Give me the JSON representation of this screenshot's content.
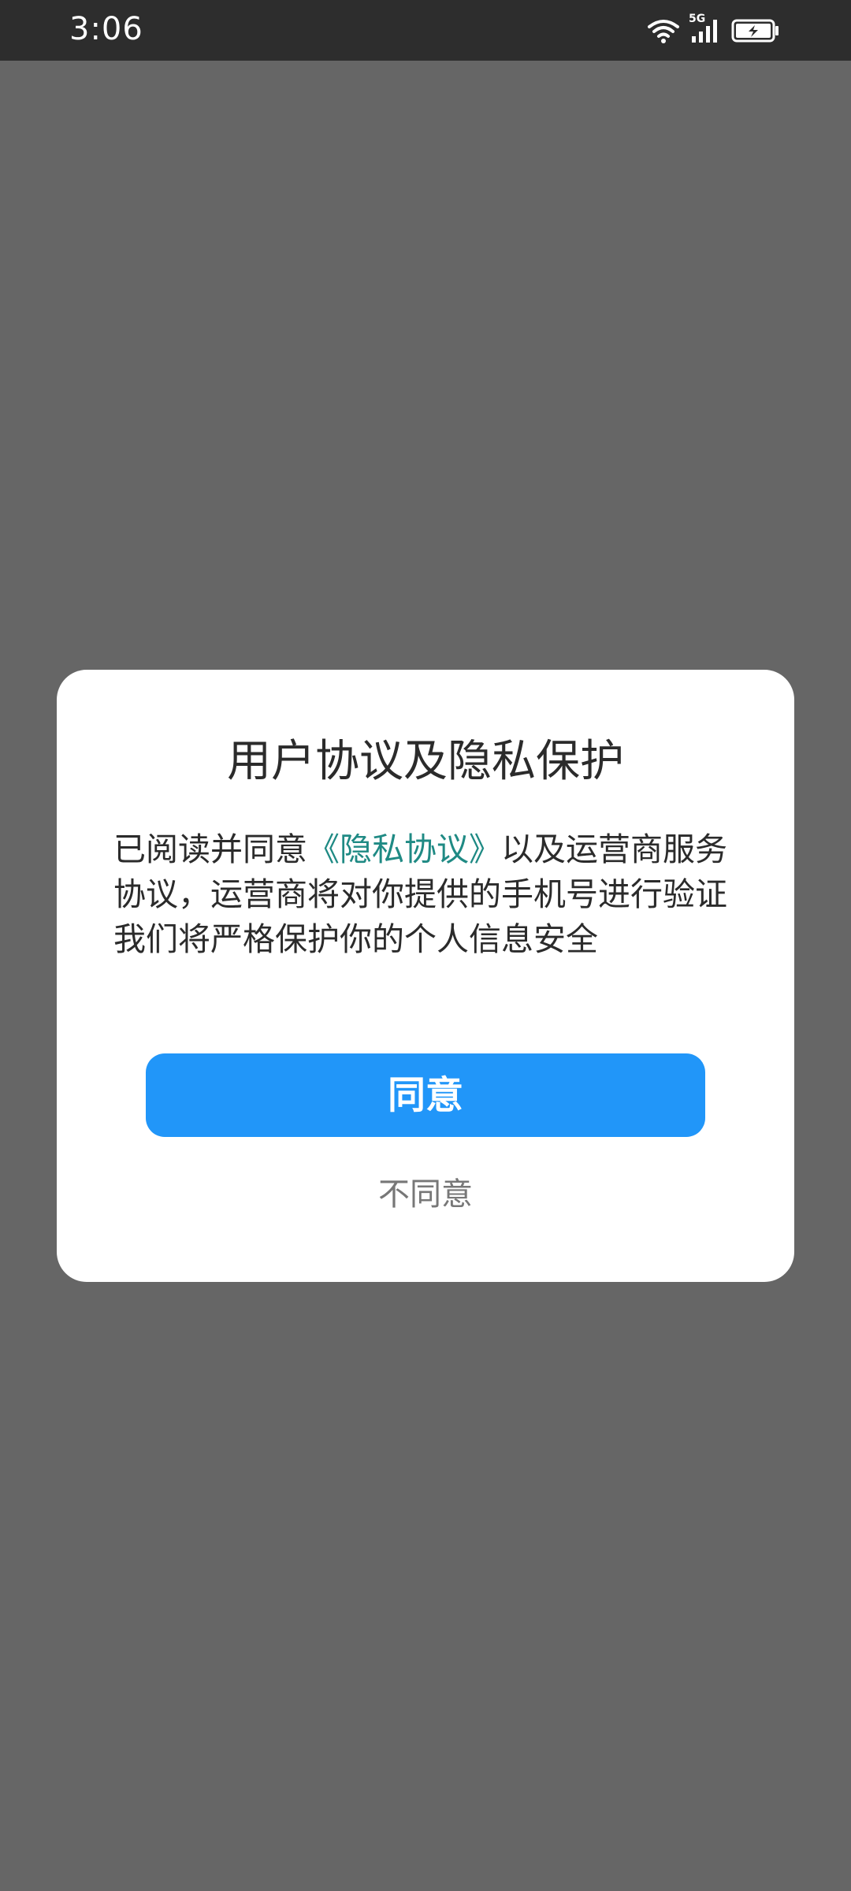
{
  "status_bar": {
    "time": "3:06",
    "network_label": "5G",
    "icons": [
      "wifi-icon",
      "cellular-signal-icon",
      "battery-charging-icon"
    ]
  },
  "dialog": {
    "title": "用户协议及隐私保护",
    "body_prefix": "已阅读并同意",
    "privacy_link": "《隐私协议》",
    "body_suffix": "以及运营商服务协议，运营商将对你提供的手机号进行验证",
    "body_line2": "我们将严格保护你的个人信息安全",
    "agree_label": "同意",
    "disagree_label": "不同意"
  },
  "colors": {
    "accent": "#2196f9",
    "link": "#1f8a84",
    "scrim": "#666666",
    "status_bar": "#2d2d2d"
  }
}
